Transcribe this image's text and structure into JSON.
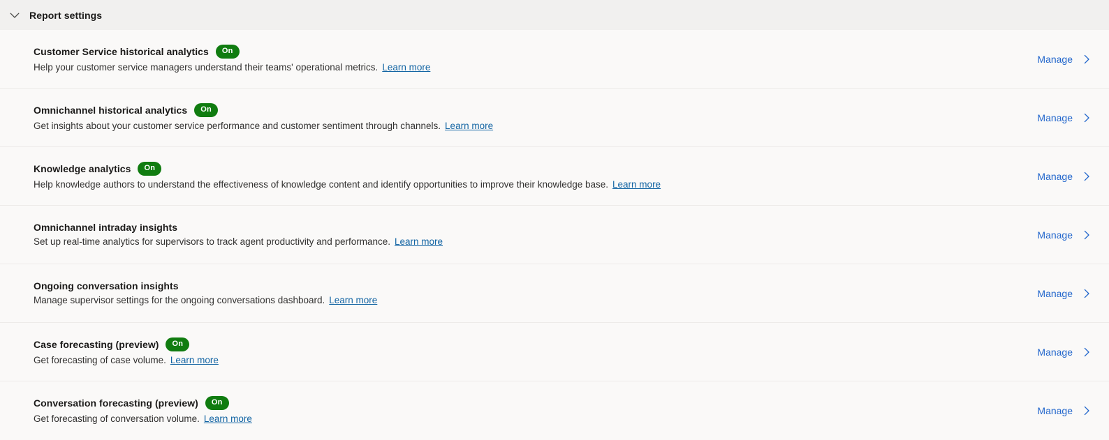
{
  "header": {
    "title": "Report settings",
    "toggle_icon": "chevron-down-icon",
    "expanded": true
  },
  "common": {
    "learn_more_label": "Learn more",
    "manage_label": "Manage",
    "manage_icon": "chevron-right-icon",
    "badge_on_label": "On"
  },
  "colors": {
    "header_background": "#f1f0ef",
    "body_background": "#faf9f8",
    "divider": "#edebe9",
    "badge_on": "#107c10",
    "link": "#1264a3",
    "manage_link": "#2266cc",
    "title_text": "#1b1a19",
    "body_text": "#323130"
  },
  "rows": [
    {
      "title": "Customer Service historical analytics",
      "badge": "On",
      "description": "Help your customer service managers understand their teams' operational metrics.",
      "learn_more": "Learn more",
      "action": "Manage"
    },
    {
      "title": "Omnichannel historical analytics",
      "badge": "On",
      "description": "Get insights about your customer service performance and customer sentiment through channels.",
      "learn_more": "Learn more",
      "action": "Manage"
    },
    {
      "title": "Knowledge analytics",
      "badge": "On",
      "description": "Help knowledge authors to understand the effectiveness of knowledge content and identify opportunities to improve their knowledge base.",
      "learn_more": "Learn more",
      "action": "Manage"
    },
    {
      "title": "Omnichannel intraday insights",
      "badge": "",
      "description": "Set up real-time analytics for supervisors to track agent productivity and performance.",
      "learn_more": "Learn more",
      "action": "Manage"
    },
    {
      "title": "Ongoing conversation insights",
      "badge": "",
      "description": "Manage supervisor settings for the ongoing conversations dashboard.",
      "learn_more": "Learn more",
      "action": "Manage"
    },
    {
      "title": "Case forecasting (preview)",
      "badge": "On",
      "description": "Get forecasting of case volume.",
      "learn_more": "Learn more",
      "action": "Manage"
    },
    {
      "title": "Conversation forecasting (preview)",
      "badge": "On",
      "description": "Get forecasting of conversation volume.",
      "learn_more": "Learn more",
      "action": "Manage"
    }
  ]
}
